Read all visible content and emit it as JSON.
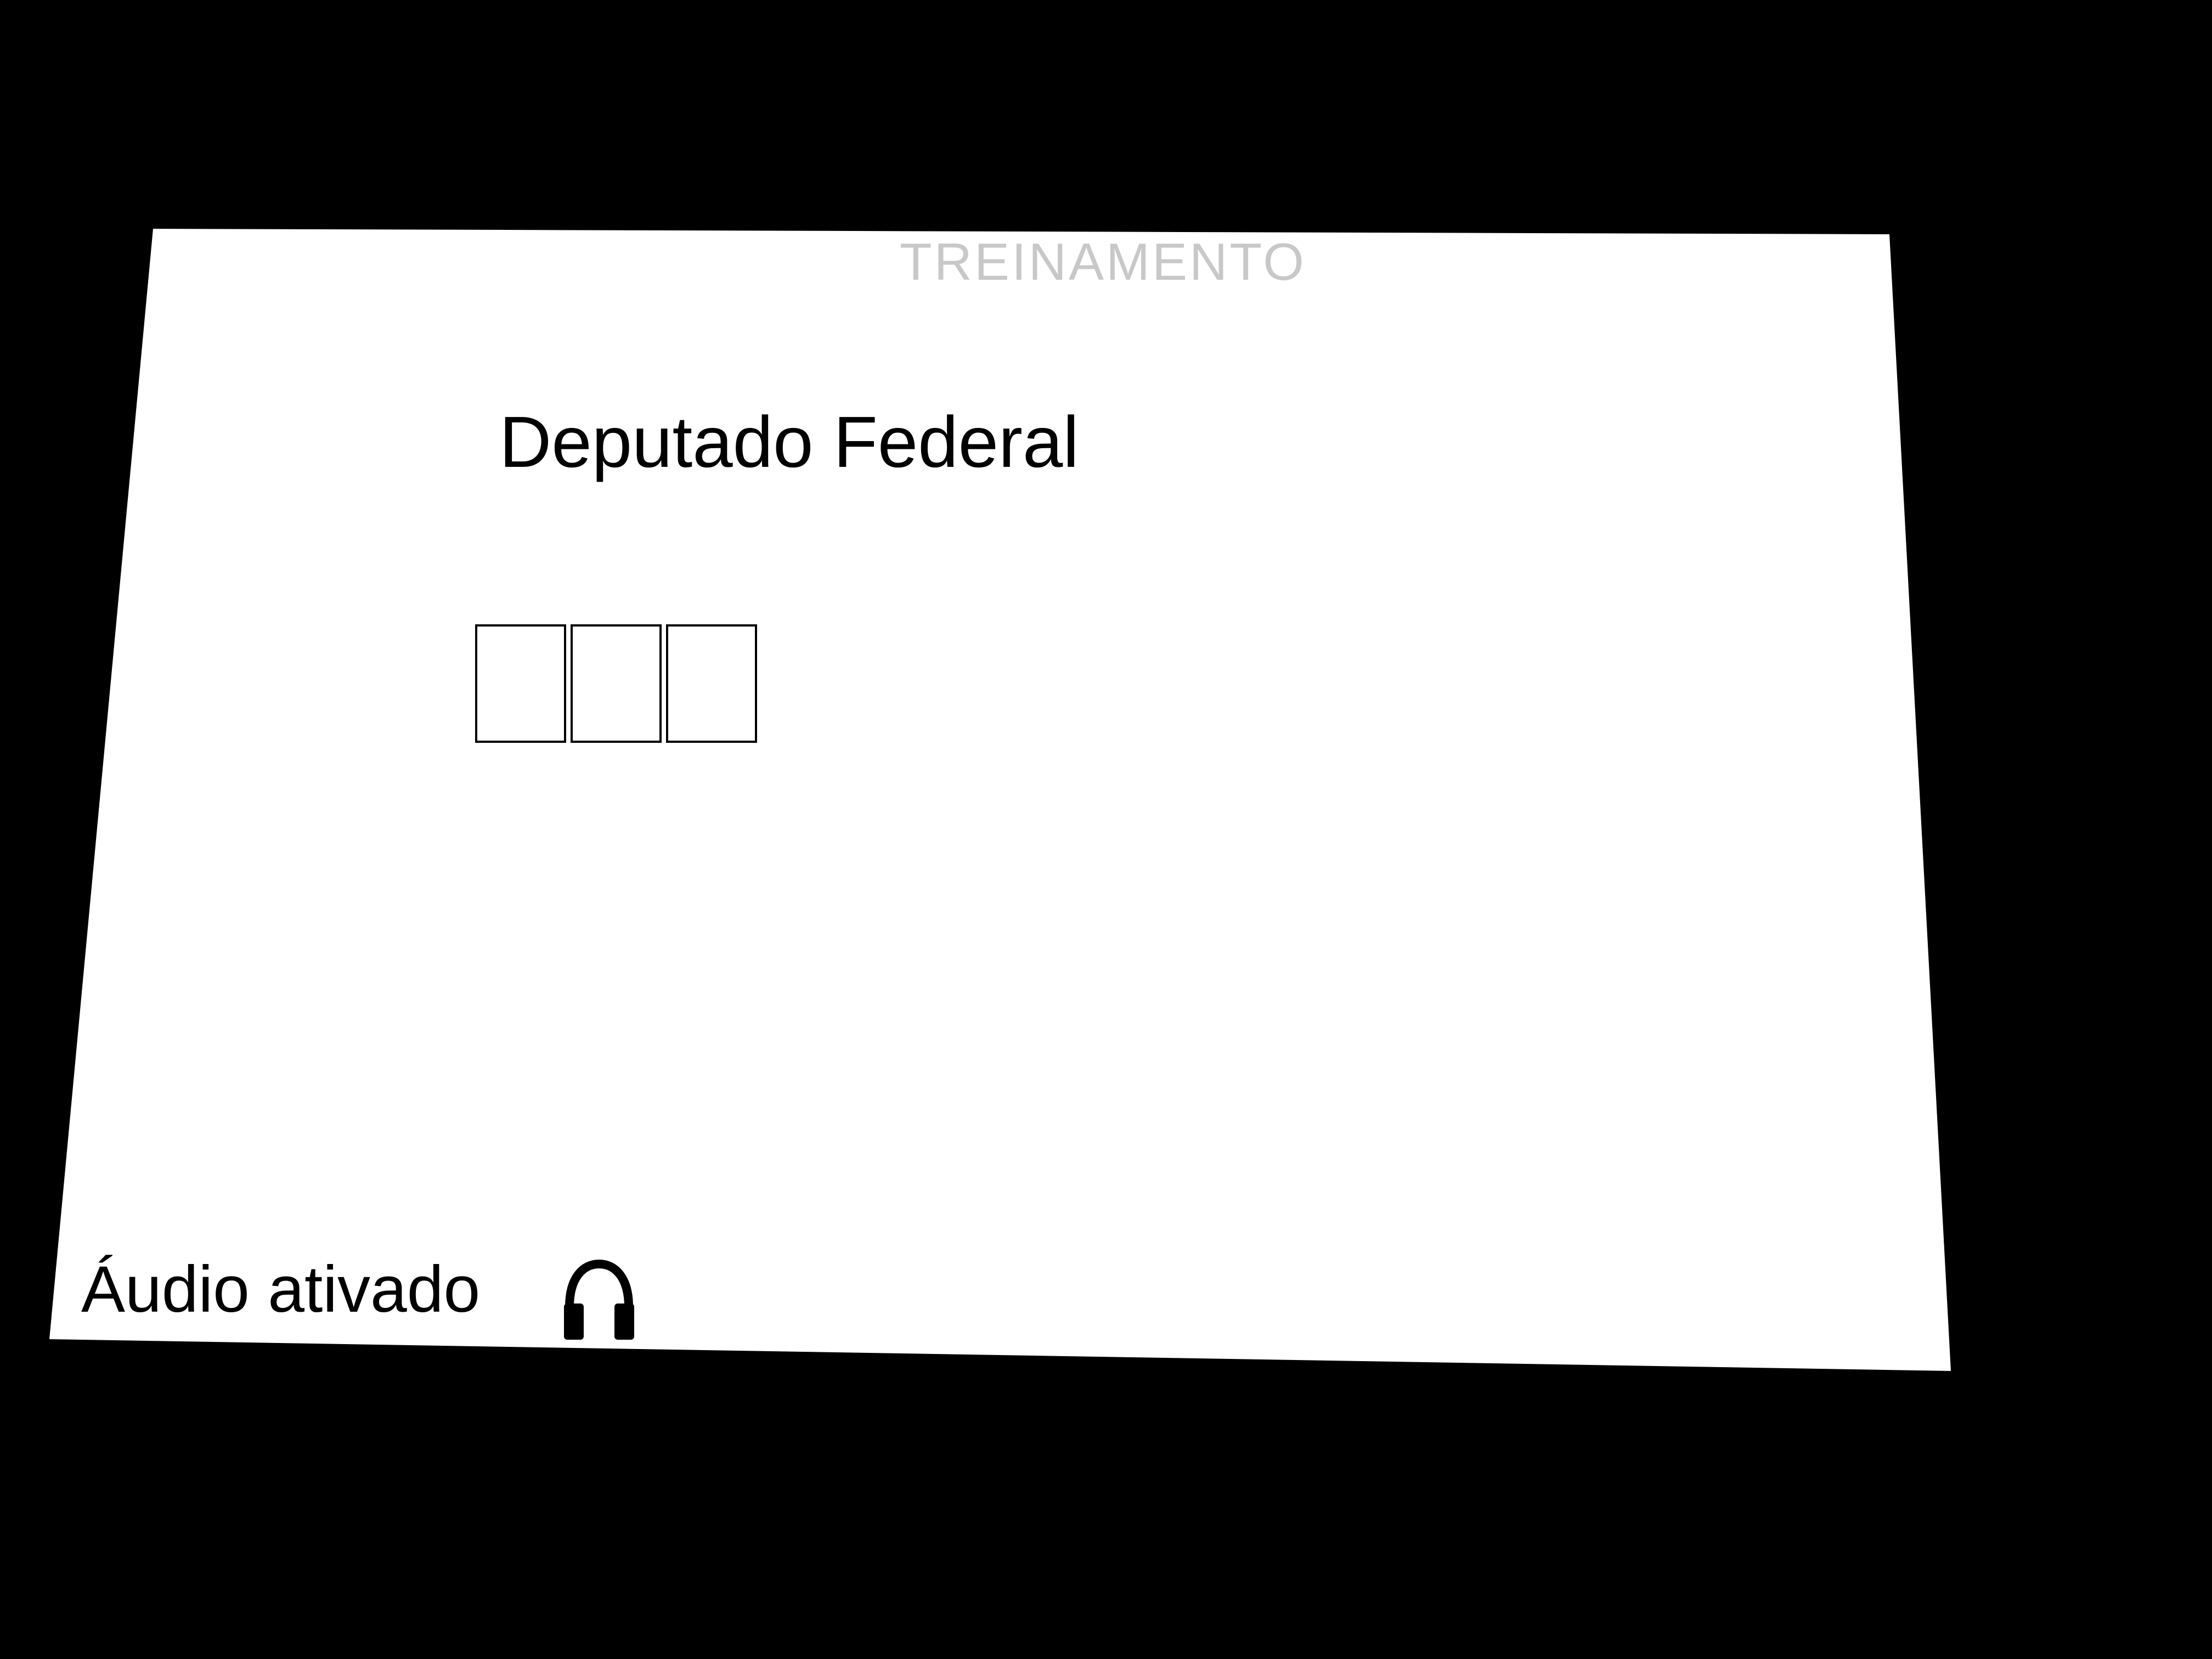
{
  "screen": {
    "watermark": "TREINAMENTO",
    "office_title": "Deputado Federal",
    "vote_digit_boxes": [
      "",
      "",
      ""
    ],
    "audio_status": "Áudio ativado",
    "audio_icon": "headphones-icon"
  },
  "colors": {
    "background": "#000000",
    "screen": "#ffffff",
    "text": "#000000",
    "watermark": "#c8c8c8"
  }
}
